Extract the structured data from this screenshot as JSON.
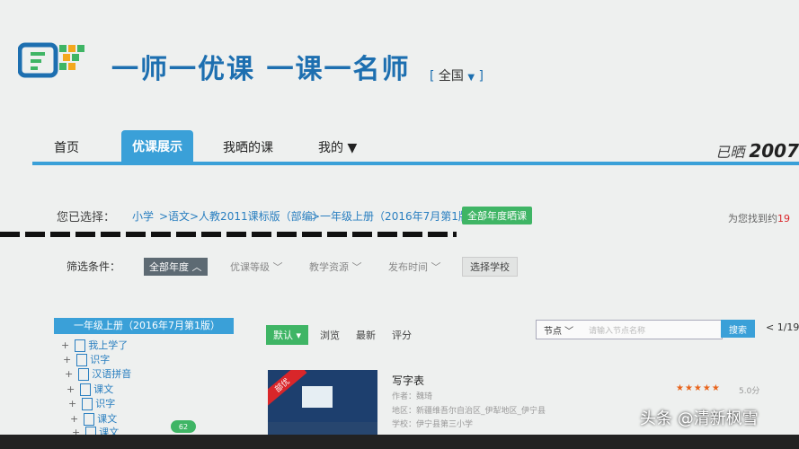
{
  "header": {
    "title": "一师一优课 一课一名师",
    "region_open": "[",
    "region_label": "全国",
    "region_arrow": "▼",
    "region_close": "]"
  },
  "nav": {
    "home": "首页",
    "showcase": "优课展示",
    "my_shared": "我晒的课",
    "mine": "我的 ▼",
    "shared_label": "已晒",
    "shared_count": "2007"
  },
  "selection": {
    "label": "您已选择：",
    "crumbs": [
      "小学",
      ">语文",
      ">人教2011课标版（部编）",
      ">一年级上册（2016年7月第1版）"
    ],
    "all_years": "全部年度晒课",
    "found_text": "为您找到约",
    "found_count": "19"
  },
  "filter": {
    "label": "筛选条件：",
    "all_years": "全部年度 ︿",
    "options": [
      "优课等级 ﹀",
      "教学资源 ﹀",
      "发布时间 ﹀"
    ],
    "choose_school": "选择学校"
  },
  "tree": {
    "root": "一年级上册（2016年7月第1版）",
    "items": [
      "我上学了",
      "识字",
      "汉语拼音",
      "课文",
      "识字",
      "课文",
      "课文"
    ]
  },
  "sort": {
    "default": "默认 ▾",
    "browse": "浏览",
    "latest": "最新",
    "rating": "评分"
  },
  "search": {
    "node": "节点 ﹀",
    "placeholder": "请输入节点名称",
    "button": "搜索",
    "pager": "< 1/19"
  },
  "course": {
    "badge": "部优",
    "title": "写字表",
    "author": "作者：魏琦",
    "region": "地区：新疆维吾尔自治区_伊犁地区_伊宁县",
    "school": "学校：伊宁县第三小学",
    "stars": "★★★★★",
    "score": "5.0分"
  },
  "misc": {
    "green_badge": "62",
    "watermark": "头条 @清新枫雪"
  },
  "colors": {
    "brand_blue": "#3aa0d8",
    "title_blue": "#1d6fb0",
    "green": "#3fb565",
    "red": "#d9262a"
  }
}
